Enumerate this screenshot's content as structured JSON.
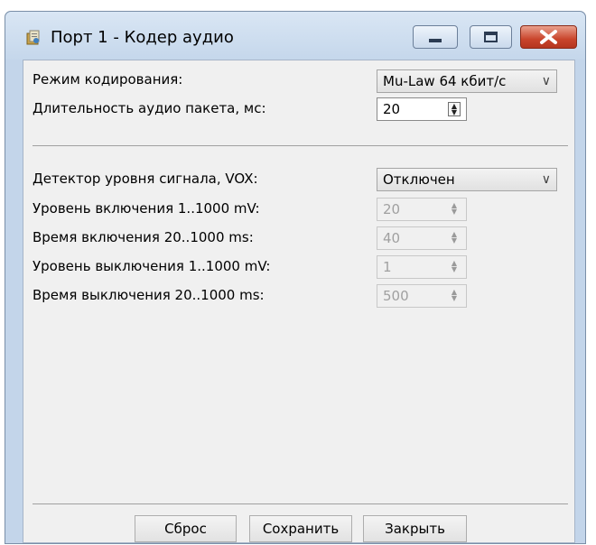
{
  "window": {
    "title": "Порт 1 - Кодер аудио"
  },
  "encoding": {
    "mode_label": "Режим кодирования:",
    "mode_value": "Mu-Law 64 кбит/с",
    "packet_label": "Длительность аудио пакета, мс:",
    "packet_value": "20"
  },
  "vox": {
    "detector_label": "Детектор уровня сигнала, VOX:",
    "detector_value": "Отключен",
    "on_level_label": "Уровень включения 1..1000 mV:",
    "on_level_value": "20",
    "on_time_label": "Время включения 20..1000 ms:",
    "on_time_value": "40",
    "off_level_label": "Уровень выключения 1..1000 mV:",
    "off_level_value": "1",
    "off_time_label": "Время выключения 20..1000 ms:",
    "off_time_value": "500"
  },
  "buttons": {
    "reset": "Сброс",
    "save": "Сохранить",
    "close": "Закрыть"
  },
  "icons": {
    "app": "app-document-icon",
    "minimize": "minimize-icon",
    "maximize": "maximize-icon",
    "close": "close-icon",
    "dropdown": "chevron-down-icon",
    "spinner": "spinner-arrows-icon"
  }
}
